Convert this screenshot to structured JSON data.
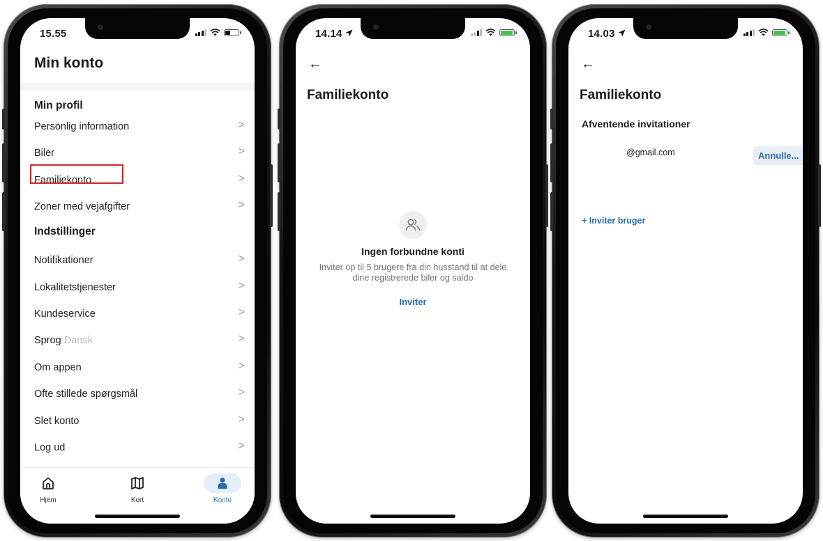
{
  "phones": [
    {
      "status_time": "15.55",
      "title": "Min konto",
      "section_profile": "Min profil",
      "profile_items": [
        "Personlig information",
        "Biler",
        "Familiekonto",
        "Zoner med vejafgifter"
      ],
      "section_settings": "Indstillinger",
      "settings_items": [
        "Notifikationer",
        "Lokalitetstjenester",
        "Kundeservice",
        "Sprog",
        "Om appen",
        "Ofte stillede spørgsmål",
        "Slet konto",
        "Log ud"
      ],
      "language_value": "Dansk",
      "tabs": [
        "Hjem",
        "Kort",
        "Konto"
      ],
      "active_tab": "Konto"
    },
    {
      "status_time": "14.14",
      "title": "Familiekonto",
      "empty_title": "Ingen forbundne konti",
      "empty_text": "Inviter op til 5 brugere fra din husstand til at dele dine registrerede biler og saldo",
      "invite_label": "Inviter"
    },
    {
      "status_time": "14.03",
      "title": "Familiekonto",
      "pending_heading": "Afventende invitationer",
      "pending_email": "@gmail.com",
      "cancel_label": "Annulle...",
      "invite_user_label": "+ Inviter bruger"
    }
  ],
  "colors": {
    "accent": "#2b6cb0",
    "highlight": "#d0262b",
    "battery_charging": "#3fc34a"
  }
}
